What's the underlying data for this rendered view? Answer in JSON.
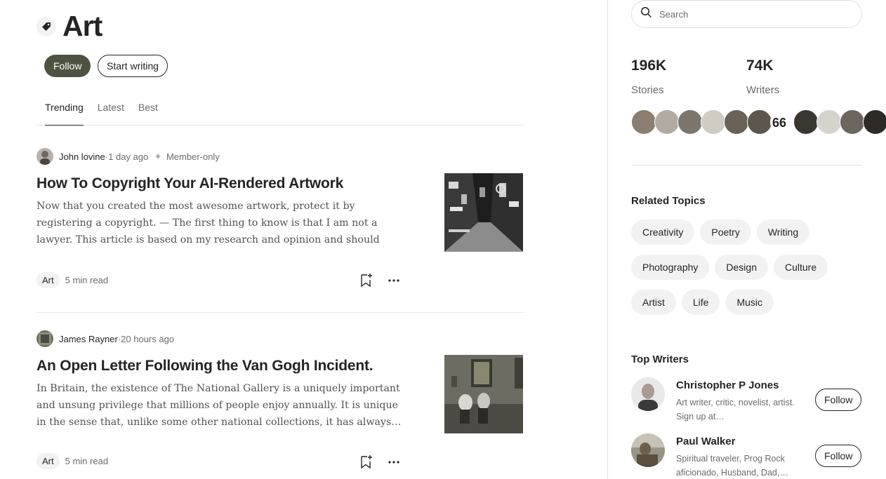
{
  "topic": {
    "title": "Art",
    "icon": "tag-icon"
  },
  "actions": {
    "follow_label": "Follow",
    "start_writing_label": "Start writing"
  },
  "tabs": [
    {
      "label": "Trending",
      "active": true
    },
    {
      "label": "Latest",
      "active": false
    },
    {
      "label": "Best",
      "active": false
    }
  ],
  "articles": [
    {
      "author": "John lovine",
      "separator": " · ",
      "time": "1 day ago",
      "member_label": "Member-only",
      "title": "How To Copyright Your AI-Rendered Artwork",
      "excerpt": "Now that you created the most awesome artwork, protect it by registering a copyright. — The first thing to know is that I am not a lawyer. This article is based on my research and opinion and should no…",
      "tag": "Art",
      "read_time": "5 min read"
    },
    {
      "author": "James Rayner",
      "separator": " · ",
      "time": "20 hours ago",
      "title": "An Open Letter Following the Van Gogh Incident.",
      "excerpt": "In Britain, the existence of The National Gallery is a uniquely important and unsung privilege that millions of people enjoy annually. It is unique in the sense that, unlike some other national collections, it has always…",
      "tag": "Art",
      "read_time": "5 min read"
    }
  ],
  "sidebar": {
    "search_placeholder": "Search",
    "stats": {
      "stories_count": "196K",
      "stories_label": "Stories",
      "writers_count": "74K",
      "writers_label": "Writers"
    },
    "related_topics_title": "Related Topics",
    "related_topics": [
      [
        "Creativity",
        "Poetry",
        "Writing"
      ],
      [
        "Photography",
        "Design",
        "Culture"
      ],
      [
        "Artist",
        "Life",
        "Music"
      ]
    ],
    "top_writers_title": "Top Writers",
    "top_writers": [
      {
        "name": "Christopher P Jones",
        "bio": "Art writer, critic, novelist, artist. Sign up at…",
        "follow_label": "Follow"
      },
      {
        "name": "Paul Walker",
        "bio": "Spiritual traveler, Prog Rock aficionado, Husband, Dad,…",
        "follow_label": "Follow"
      }
    ]
  },
  "colors": {
    "follow_button_bg": "#4d5340",
    "text_primary": "#242424",
    "text_secondary": "#6b6b6b",
    "chip_bg": "#f2f2f2",
    "divider": "#e6e6e6"
  }
}
